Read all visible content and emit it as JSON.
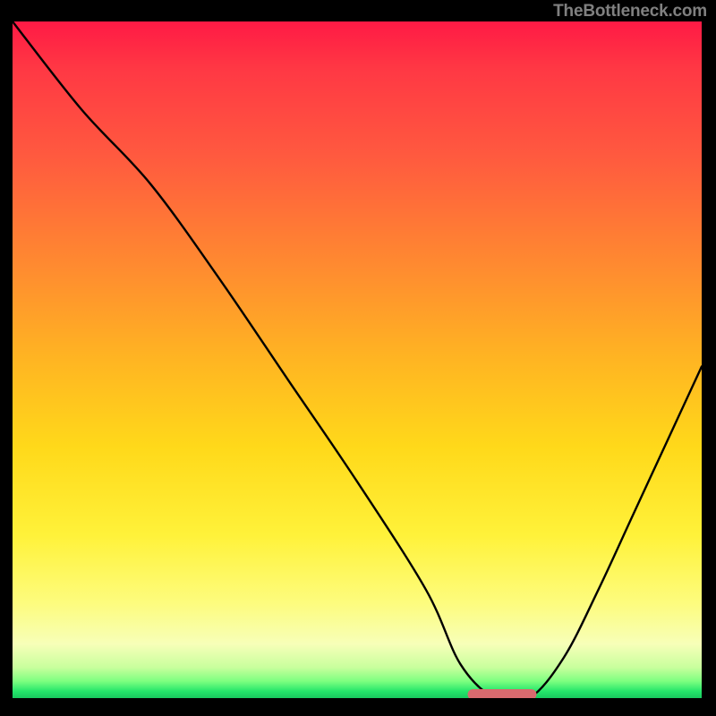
{
  "watermark": "TheBottleneck.com",
  "colors": {
    "gradient_top": "#ff1a45",
    "gradient_bottom": "#19c95f",
    "curve_stroke": "#000000",
    "marker_fill": "#d86a6e",
    "frame": "#000000"
  },
  "chart_data": {
    "type": "line",
    "title": "",
    "xlabel": "",
    "ylabel": "",
    "xlim": [
      0,
      100
    ],
    "ylim": [
      0,
      100
    ],
    "x": [
      0,
      10,
      20,
      30,
      40,
      50,
      60,
      65,
      70,
      75,
      80,
      85,
      90,
      95,
      100
    ],
    "values": [
      100,
      87,
      76,
      62,
      47,
      32,
      16,
      5,
      0,
      0,
      6,
      16,
      27,
      38,
      49
    ],
    "annotations": [
      {
        "kind": "optimal_range_marker",
        "x_start": 66,
        "x_end": 76,
        "y": 0
      }
    ]
  }
}
